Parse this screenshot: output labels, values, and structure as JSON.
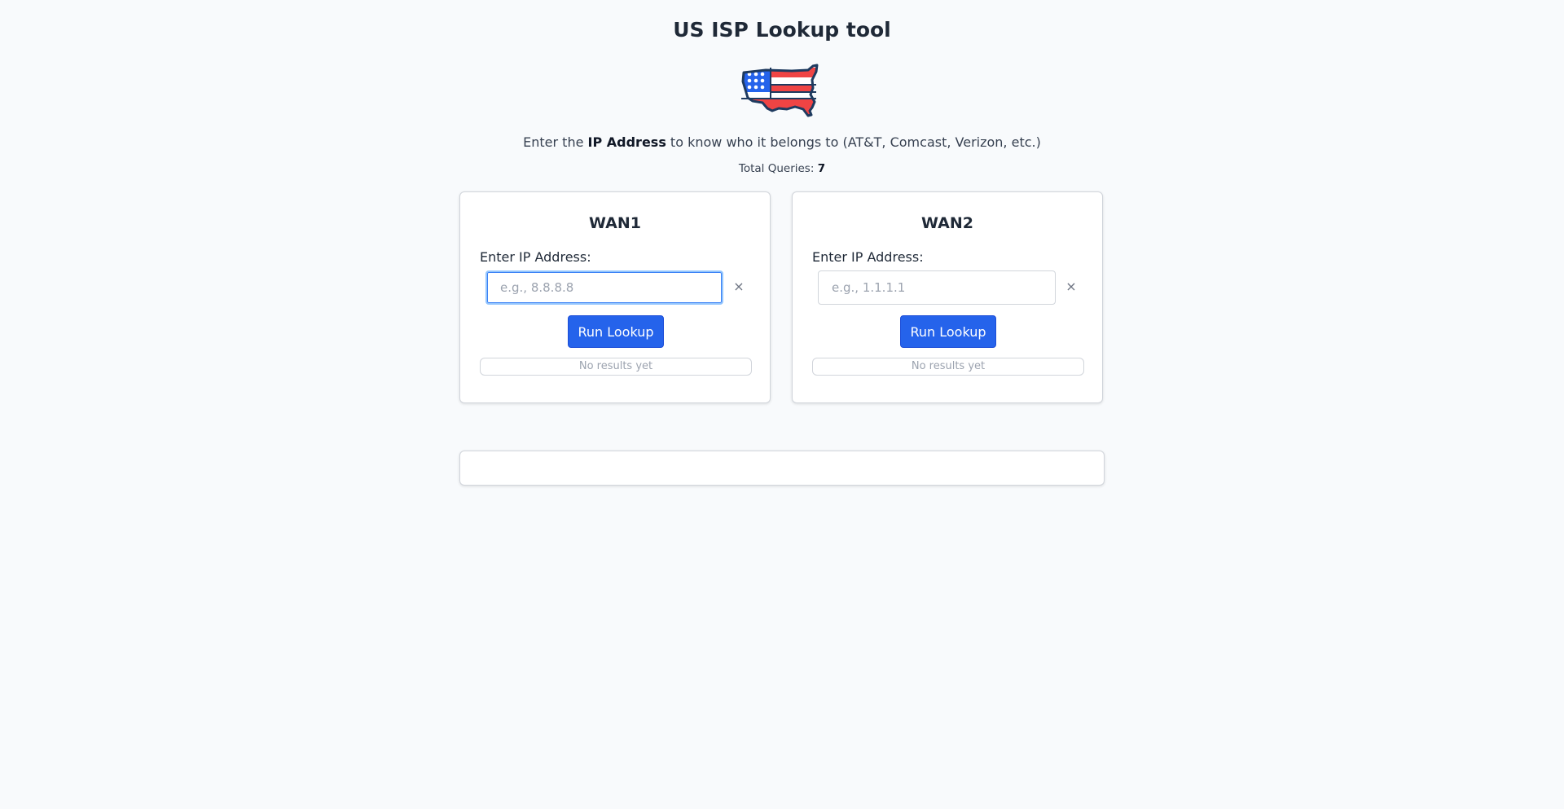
{
  "header": {
    "title": "US ISP Lookup tool",
    "logo_icon": "us-flag-map-icon",
    "subtitle_pre": "Enter the ",
    "subtitle_bold": "IP Address",
    "subtitle_post": " to know who it belongs to (AT&T, Comcast, Verizon, etc.)",
    "queries_label": "Total Queries: ",
    "queries_count": "7"
  },
  "colors": {
    "primary": "#2563eb",
    "flag_red": "#ef4444",
    "flag_blue": "#1e40af",
    "background": "#f8fafc"
  },
  "cards": [
    {
      "title": "WAN1",
      "field_label": "Enter IP Address:",
      "input_value": "",
      "placeholder": "e.g., 8.8.8.8",
      "clear_label": "×",
      "button_label": "Run Lookup",
      "results_text": "No results yet",
      "focused": true
    },
    {
      "title": "WAN2",
      "field_label": "Enter IP Address:",
      "input_value": "",
      "placeholder": "e.g., 1.1.1.1",
      "clear_label": "×",
      "button_label": "Run Lookup",
      "results_text": "No results yet",
      "focused": false
    }
  ]
}
